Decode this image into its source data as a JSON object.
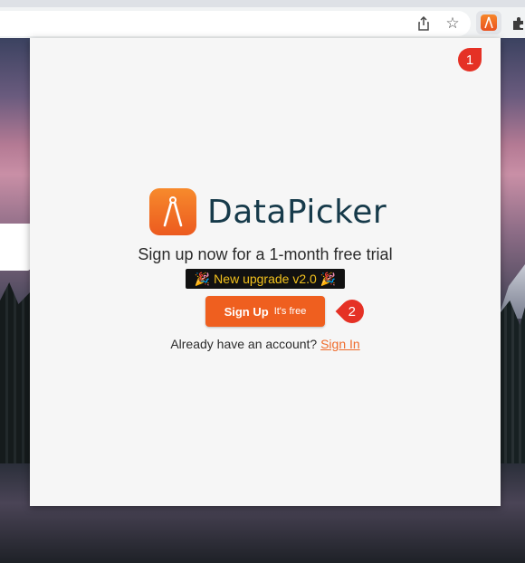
{
  "browser": {
    "icons": {
      "share": "share-icon",
      "star": "star-icon",
      "extension_active": "datapicker-extension-icon",
      "extensions": "puzzle-icon"
    }
  },
  "popup": {
    "brand_name": "DataPicker",
    "tagline": "Sign up now for a 1-month free trial",
    "upgrade_badge": "New upgrade v2.0",
    "signup": {
      "main_label": "Sign Up",
      "sub_label": "It's free"
    },
    "signin_prompt": "Already have an account?",
    "signin_link": "Sign In"
  },
  "callouts": {
    "first": "1",
    "second": "2"
  },
  "colors": {
    "accent": "#ef5f1f",
    "brand_text": "#163a4a",
    "badge_bg": "#111111",
    "badge_text": "#f3c21d",
    "callout": "#e53125"
  }
}
